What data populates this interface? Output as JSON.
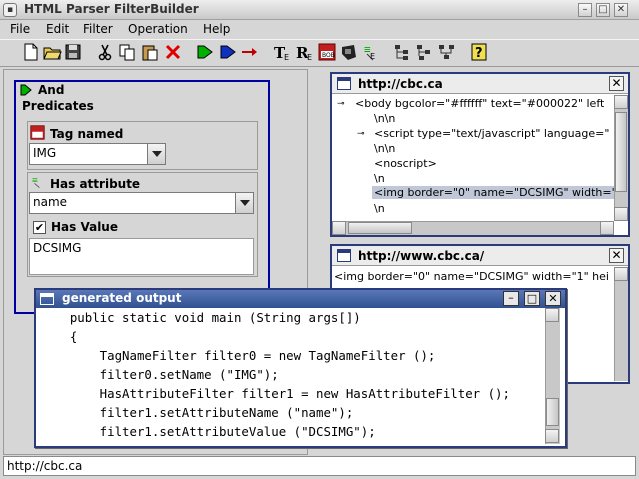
{
  "window": {
    "title": "HTML Parser FilterBuilder"
  },
  "menu": [
    {
      "label": "File"
    },
    {
      "label": "Edit"
    },
    {
      "label": "Filter"
    },
    {
      "label": "Operation"
    },
    {
      "label": "Help"
    }
  ],
  "filter_panel": {
    "and_label": "And",
    "predicates_label": "Predicates",
    "tag_named": {
      "label": "Tag named",
      "value": "IMG",
      "icon_text": "BOB"
    },
    "has_attribute": {
      "label": "Has attribute",
      "value": "name"
    },
    "has_value": {
      "label": "Has Value",
      "checked": true,
      "value": "DCSIMG"
    }
  },
  "tree_panel": {
    "title": "http://cbc.ca",
    "lines": [
      "<body bgcolor=\"#ffffff\" text=\"#000022\" left",
      "\\n\\n",
      "<script type=\"text/javascript\" language=\"",
      "\\n\\n",
      "<noscript>",
      "\\n",
      "<img border=\"0\" name=\"DCSIMG\" width=\"",
      "\\n"
    ]
  },
  "result_panel": {
    "title": "http://www.cbc.ca/",
    "line": "<img border=\"0\" name=\"DCSIMG\" width=\"1\" hei"
  },
  "output_window": {
    "title": "generated output",
    "lines": [
      "    public static void main (String args[])",
      "    {",
      "        TagNameFilter filter0 = new TagNameFilter ();",
      "        filter0.setName (\"IMG\");",
      "        HasAttributeFilter filter1 = new HasAttributeFilter ();",
      "        filter1.setAttributeName (\"name\");",
      "        filter1.setAttributeValue (\"DCSIMG\");"
    ]
  },
  "status_bar": {
    "text": "http://cbc.ca"
  },
  "colors": {
    "selection": "#c0c8d8",
    "frame": "#0000a0",
    "titlebar": "#30508f"
  }
}
